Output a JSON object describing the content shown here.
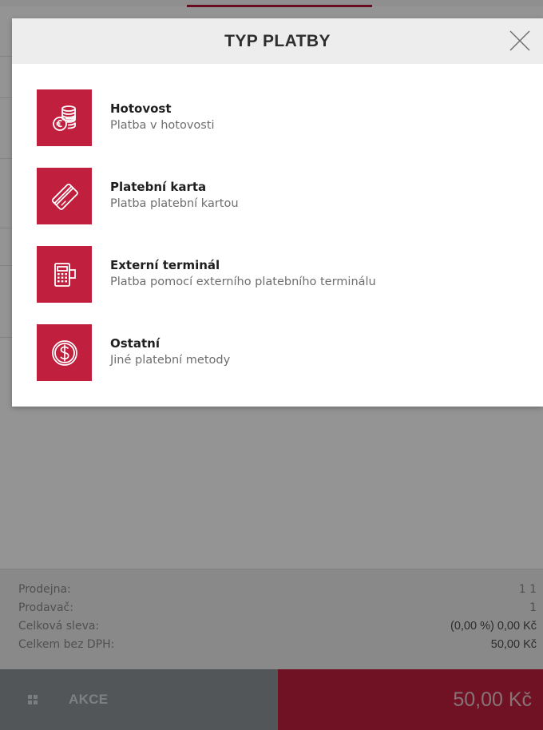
{
  "modal": {
    "title": "TYP PLATBY",
    "options": [
      {
        "title": "Hotovost",
        "subtitle": "Platba v hotovosti",
        "icon": "coins-euro-icon"
      },
      {
        "title": "Platební karta",
        "subtitle": "Platba platební kartou",
        "icon": "credit-card-icon"
      },
      {
        "title": "Externí terminál",
        "subtitle": "Platba pomocí externího platebního terminálu",
        "icon": "payment-terminal-icon"
      },
      {
        "title": "Ostatní",
        "subtitle": "Jiné platební metody",
        "icon": "dollar-coin-icon"
      }
    ],
    "close_icon": "close-icon"
  },
  "summary": {
    "rows": [
      {
        "label": "Prodejna:",
        "value": "1 1"
      },
      {
        "label": "Prodavač:",
        "value": "1"
      },
      {
        "label": "Celková sleva:",
        "value": "(0,00 %) 0,00 Kč"
      },
      {
        "label": "Celkem bez DPH:",
        "value": "50,00 Kč"
      }
    ]
  },
  "bottombar": {
    "akce_label": "AKCE",
    "total_label": "50,00 Kč"
  },
  "colors": {
    "accent": "#c11f3e",
    "overlay": "rgba(0,0,0,0.42)",
    "header_bg": "#ededed"
  }
}
